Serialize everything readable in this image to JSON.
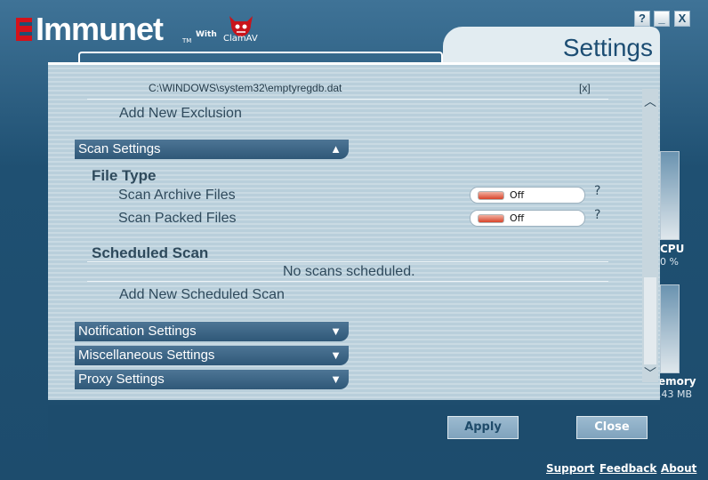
{
  "brand": {
    "name": "Immunet",
    "tm": "TM",
    "with": "With",
    "partner": "ClamAV"
  },
  "window_controls": {
    "help": "?",
    "minimize": "_",
    "close": "X"
  },
  "background_widgets": {
    "cpu_label": "CPU",
    "cpu_value": "0 %",
    "memory_label": "emory",
    "memory_value": ".43 MB"
  },
  "settings": {
    "title": "Settings",
    "exclusion": {
      "path": "C:\\WINDOWS\\system32\\emptyregdb.dat",
      "remove": "[x]",
      "add_label": "Add New Exclusion"
    },
    "scan_settings": {
      "label": "Scan Settings",
      "expanded": true,
      "file_type": {
        "heading": "File Type",
        "options": [
          {
            "label": "Scan Archive Files",
            "state": "Off",
            "help": "?"
          },
          {
            "label": "Scan Packed Files",
            "state": "Off",
            "help": "?"
          }
        ]
      },
      "scheduled_scan": {
        "heading": "Scheduled Scan",
        "empty_text": "No scans scheduled.",
        "add_label": "Add New Scheduled Scan"
      }
    },
    "collapsed_sections": [
      {
        "label": "Notification Settings"
      },
      {
        "label": "Miscellaneous Settings"
      },
      {
        "label": "Proxy Settings"
      }
    ],
    "chevron_up": "▲",
    "chevron_down": "▼",
    "scroll_up": "︿",
    "scroll_down": "﹀"
  },
  "footer": {
    "apply_label": "Apply",
    "close_label": "Close"
  },
  "links": {
    "support": "Support",
    "feedback": "Feedback",
    "about": "About"
  },
  "colors": {
    "brand_red": "#d4121a",
    "background_blue": "#1d4c6d",
    "section_bar": "#2f5878",
    "toggle_off": "#d8442a"
  }
}
